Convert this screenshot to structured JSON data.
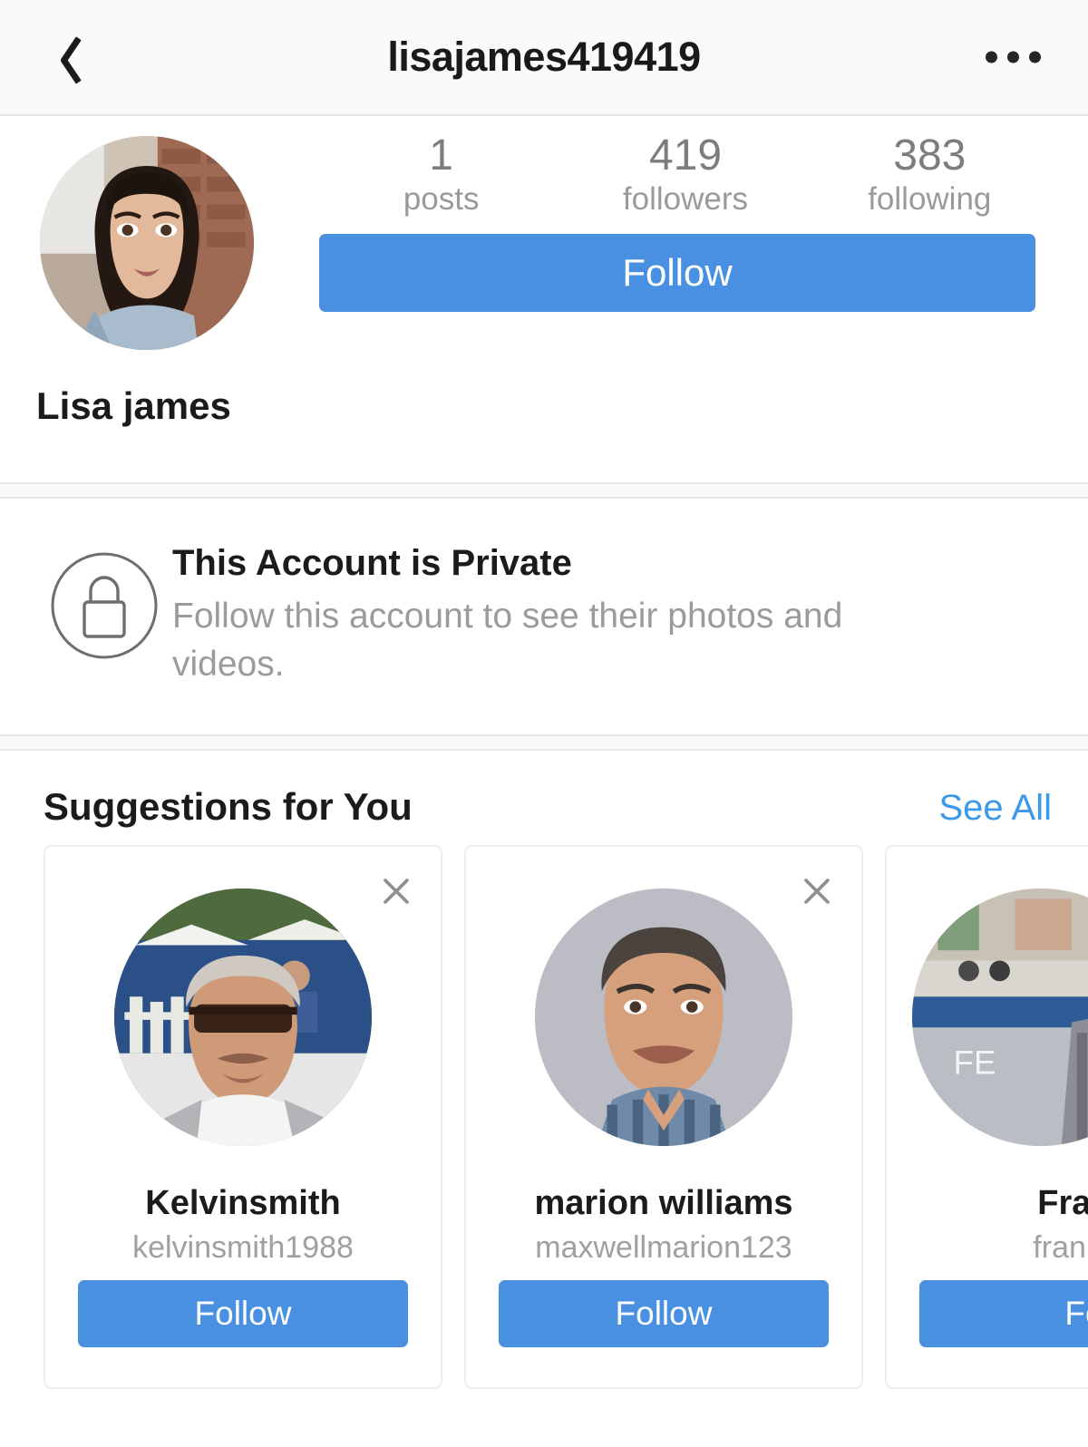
{
  "header": {
    "back_icon": "chevron-left-icon",
    "title": "lisajames419419",
    "menu_icon": "more-options-icon"
  },
  "profile": {
    "avatar_icon": "profile-avatar",
    "display_name": "Lisa james",
    "stats": [
      {
        "value": "1",
        "label": "posts"
      },
      {
        "value": "419",
        "label": "followers"
      },
      {
        "value": "383",
        "label": "following"
      }
    ],
    "follow_button": "Follow"
  },
  "private_notice": {
    "lock_icon": "lock-icon",
    "title": "This Account is Private",
    "body": "Follow this account to see their photos and videos."
  },
  "suggestions": {
    "title": "Suggestions for You",
    "see_all": "See All",
    "close_icon": "close-icon",
    "cards": [
      {
        "name": "Kelvinsmith",
        "username": "kelvinsmith1988",
        "follow_label": "Follow",
        "avatar_icon": "suggestion-avatar-kelvinsmith"
      },
      {
        "name": "marion williams",
        "username": "maxwellmarion123",
        "follow_label": "Follow",
        "avatar_icon": "suggestion-avatar-marion-williams"
      },
      {
        "name": "Frank",
        "username": "frankda",
        "follow_label": "Fo",
        "avatar_icon": "suggestion-avatar-frank"
      }
    ]
  },
  "colors": {
    "accent_blue": "#4a90e2",
    "link_blue": "#3e9ae8",
    "text_primary": "#1b1b1b",
    "text_muted": "#9b9b9b",
    "bar_background": "#fafafa"
  }
}
